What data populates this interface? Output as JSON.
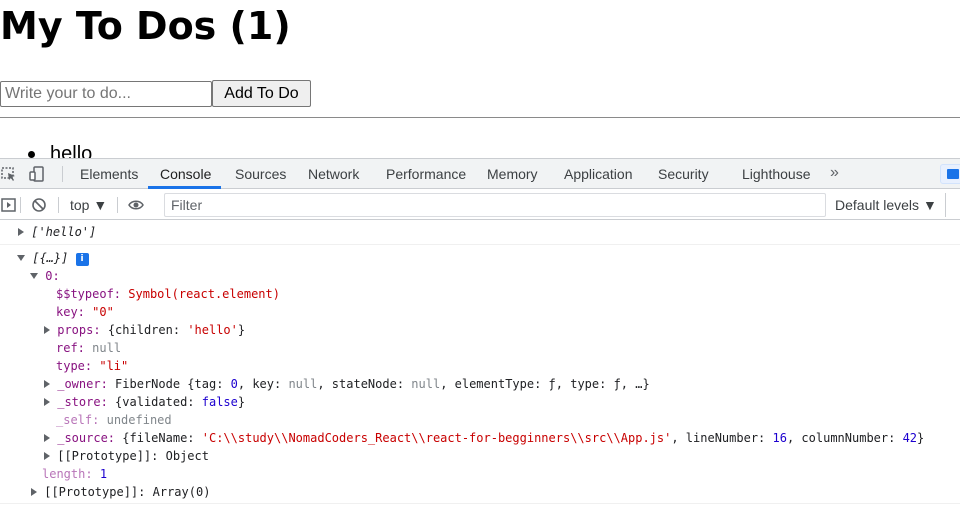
{
  "app": {
    "title": "My To Dos (1)",
    "input_placeholder": "Write your to do...",
    "add_button": "Add To Do",
    "todos": [
      "hello"
    ]
  },
  "devtools": {
    "tabs": [
      "Elements",
      "Console",
      "Sources",
      "Network",
      "Performance",
      "Memory",
      "Application",
      "Security",
      "Lighthouse"
    ],
    "active_tab": "Console",
    "more_tabs": "»",
    "context": "top",
    "filter_placeholder": "Filter",
    "levels": "Default levels",
    "colors": {
      "accent": "#1a73e8",
      "key": "#881280",
      "string": "#c80000",
      "number": "#1c00cf",
      "dim": "#80868b"
    }
  },
  "console": {
    "msg1": "['hello']",
    "msg2": "[{…}]",
    "info": "i",
    "index0": "0:",
    "typeof_key": "$$typeof:",
    "typeof_val": "Symbol(react.element)",
    "key_key": "key:",
    "key_val": "\"0\"",
    "props_key": "props:",
    "props_open": "{children: ",
    "props_val": "'hello'",
    "props_close": "}",
    "ref_key": "ref:",
    "ref_val": "null",
    "type_key": "type:",
    "type_val": "\"li\"",
    "owner_key": "_owner:",
    "owner_1": "FiberNode {tag: ",
    "owner_tag": "0",
    "owner_2": ", key: ",
    "owner_key_val": "null",
    "owner_3": ", stateNode: ",
    "owner_state": "null",
    "owner_4": ", elementType: ƒ, type: ƒ, …}",
    "store_key": "_store:",
    "store_1": "{validated: ",
    "store_val": "false",
    "store_2": "}",
    "self_key": "_self:",
    "self_val": "undefined",
    "source_key": "_source:",
    "source_1": "{fileName: ",
    "source_file": "'C:\\\\study\\\\NomadCoders_React\\\\react-for-begginners\\\\src\\\\App.js'",
    "source_2": ", lineNumber: ",
    "source_line": "16",
    "source_3": ", columnNumber: ",
    "source_col": "42",
    "source_4": "}",
    "proto_obj_key": "[[Prototype]]:",
    "proto_obj_val": "Object",
    "length_key": "length:",
    "length_val": "1",
    "proto_arr_key": "[[Prototype]]:",
    "proto_arr_val": "Array(0)"
  }
}
